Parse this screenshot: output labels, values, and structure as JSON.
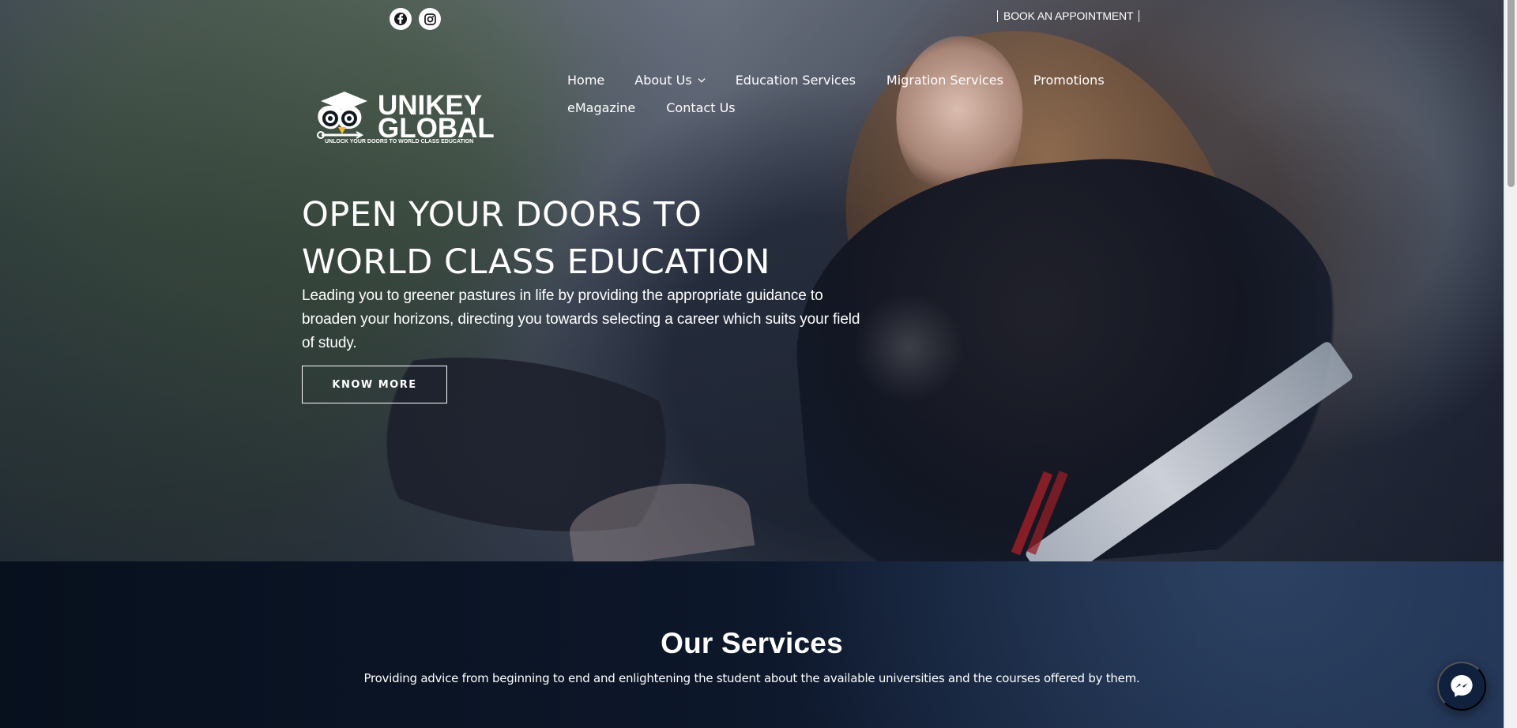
{
  "header": {
    "appointment": "BOOK AN APPOINTMENT",
    "social_links": [
      {
        "icon": "facebook-icon"
      },
      {
        "icon": "instagram-icon"
      }
    ]
  },
  "brand": {
    "logo_top": "UNIKEY",
    "logo_bottom": "GLOBAL",
    "tagline": "UNLOCK YOUR DOORS TO WORLD CLASS EDUCATION",
    "color": "#ffffff"
  },
  "navigation": {
    "items": [
      {
        "label": "Home"
      },
      {
        "label": "About Us"
      },
      {
        "label": "Education Services"
      },
      {
        "label": "Migration Services"
      },
      {
        "label": "Promotions"
      },
      {
        "label": "eMagazine"
      },
      {
        "label": "Contact Us"
      }
    ]
  },
  "hero": {
    "title_line_1": "OPEN YOUR DOORS TO",
    "title_line_2": "WORLD CLASS EDUCATION",
    "description": "Leading you to greener pastures in life by providing the appropriate guidance to broaden your horizons, directing you towards selecting a career which suits your field of study.",
    "button": "KNOW MORE"
  },
  "services": {
    "title": "Our Services",
    "description": "Providing advice from beginning to end and enlightening the student about the available universities and the courses offered by them."
  },
  "chat": {
    "icon": "messenger-icon",
    "color": "#10213d"
  }
}
